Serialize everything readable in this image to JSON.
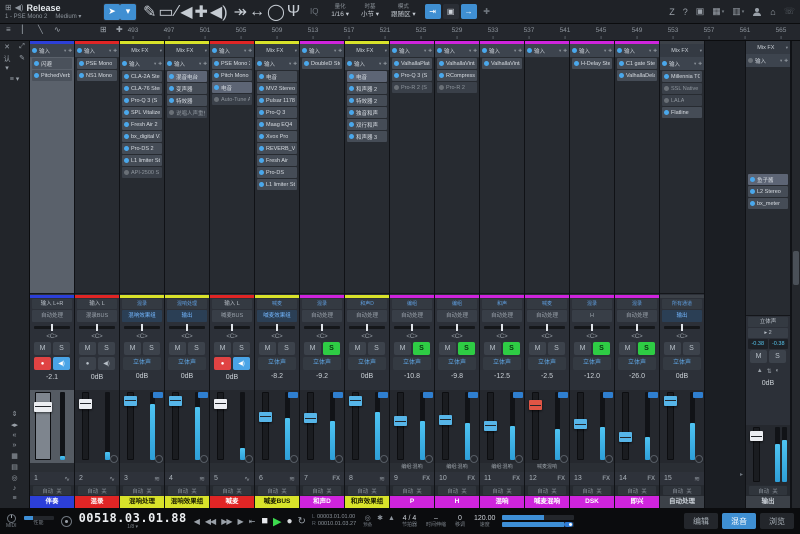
{
  "topbar": {
    "song_title": "Release",
    "selected_item": "1 - PSE Mono 2",
    "buffer": "Medium ▾",
    "window_icons": [
      "⊞",
      "◀)"
    ],
    "arrow_tool": "➤",
    "tools": [
      "✎",
      "▭",
      "∕",
      "◀",
      "✚",
      "◀)"
    ],
    "nav_tools": [
      "↠",
      "↔",
      "◯",
      "Ψ"
    ],
    "iq_label": "IQ",
    "quantize": {
      "label": "量化",
      "value": "1/16 ▾"
    },
    "timebase": {
      "label": "时基",
      "value": "小节 ▾"
    },
    "mode": {
      "label": "模式",
      "value": "跟随区 ▾"
    },
    "action_chips": [
      "⇥",
      "▣",
      "→",
      "✚"
    ],
    "right_icons": [
      "Z",
      "?",
      "▣",
      "▦ ▾",
      "▥ ▾",
      "⌂",
      "☏"
    ]
  },
  "toolbar2": {
    "icons_left": [
      "≡",
      "▏",
      "╲",
      "∿"
    ],
    "icons_mid": [
      "⊞",
      "✚"
    ]
  },
  "ruler": {
    "numbers": [
      493,
      497,
      501,
      505,
      509,
      513,
      517,
      521,
      525,
      529,
      533,
      537,
      541,
      545,
      549,
      553,
      557,
      561,
      565
    ]
  },
  "left_rail": {
    "top_icons": [
      "✕",
      "⤢",
      "认 ▾",
      "✎",
      "≡ ▾"
    ],
    "bottom_icons": [
      "⇕",
      "◂▸",
      "«",
      "»",
      "▦",
      "▤",
      "◎",
      "♪",
      "≡"
    ]
  },
  "labels": {
    "mixfx": "Mix FX",
    "input": "输入",
    "auto": "自动",
    "auto_state": "关",
    "pan_center": "<C>",
    "mute": "M",
    "solo": "S",
    "stereo": "立体声",
    "rec_glyph": "●",
    "mon_glyph": "◀)"
  },
  "channels": [
    {
      "num": "1",
      "name": "伴奏",
      "color": "#2c3fd8",
      "tc": "#ffffff",
      "selected": true,
      "mixfx": false,
      "inserts": [
        {
          "n": "闪避",
          "s": "hl"
        },
        {
          "n": "PitchedVerb",
          "s": ""
        }
      ],
      "input": "输入 L+R",
      "input_small": false,
      "bus": "自动处理",
      "bus_hl": false,
      "recmon": "rec",
      "rec_on": true,
      "solo_on": false,
      "gain": "-2.1",
      "cap": "#eceef2",
      "cappos": 16,
      "meter": 6,
      "icon": "∿",
      "send": "",
      "badge": false
    },
    {
      "num": "2",
      "name": "混录",
      "color": "#e02525",
      "tc": "#ffffff",
      "selected": false,
      "mixfx": false,
      "inserts": [
        {
          "n": "PSE Mono",
          "s": ""
        },
        {
          "n": "NS1 Mono",
          "s": ""
        }
      ],
      "input": "输入 L",
      "input_small": false,
      "bus": "混录BUS",
      "bus_hl": false,
      "recmon": "rec",
      "rec_on": false,
      "solo_on": false,
      "gain": "0dB",
      "cap": "#eceef2",
      "cappos": 12,
      "meter": 12,
      "icon": "∿",
      "send": "",
      "badge": false
    },
    {
      "num": "3",
      "name": "混响处理",
      "color": "#d8e22a",
      "tc": "#1a1d00",
      "selected": false,
      "mixfx": true,
      "inserts": [
        {
          "n": "CLA-2A Ster",
          "s": ""
        },
        {
          "n": "CLA-76 Ster",
          "s": ""
        },
        {
          "n": "Pro-Q 3 (S",
          "s": ""
        },
        {
          "n": "SPL Vitalizer",
          "s": ""
        },
        {
          "n": "Fresh Air 2",
          "s": ""
        },
        {
          "n": "bx_digital V3",
          "s": ""
        },
        {
          "n": "Pro-DS 2",
          "s": ""
        },
        {
          "n": "L1 limiter St",
          "s": ""
        },
        {
          "n": "API-2500 S",
          "s": "dim"
        }
      ],
      "input": "混录",
      "input_small": true,
      "bus": "混响效果组",
      "bus_hl": true,
      "recmon": "stereo",
      "rec_on": false,
      "solo_on": false,
      "gain": "0dB",
      "cap": "#56b5e8",
      "cappos": 8,
      "meter": 82,
      "icon": "≋",
      "send": "",
      "badge": true
    },
    {
      "num": "4",
      "name": "混响效果组",
      "color": "#d8e22a",
      "tc": "#1a1d00",
      "selected": false,
      "mixfx": true,
      "inserts": [
        {
          "n": "混音电台",
          "s": "hl"
        },
        {
          "n": "变声器",
          "s": ""
        },
        {
          "n": "特效器",
          "s": ""
        },
        {
          "n": "说唱人声重叠",
          "s": "dim"
        }
      ],
      "input": "混响处理",
      "input_small": true,
      "bus": "输出",
      "bus_hl": true,
      "recmon": "stereo",
      "rec_on": false,
      "solo_on": false,
      "gain": "0dB",
      "cap": "#56b5e8",
      "cappos": 8,
      "meter": 78,
      "icon": "≋",
      "send": "",
      "badge": true
    },
    {
      "num": "5",
      "name": "喊麦",
      "color": "#e02525",
      "tc": "#ffffff",
      "selected": false,
      "mixfx": false,
      "inserts": [
        {
          "n": "PSE Mono 2",
          "s": ""
        },
        {
          "n": "Pitch Mono",
          "s": ""
        },
        {
          "n": "电音",
          "s": "hl"
        },
        {
          "n": "Auto-Tune Ar",
          "s": "dim"
        }
      ],
      "input": "输入 L",
      "input_small": false,
      "bus": "喊麦BUS",
      "bus_hl": false,
      "recmon": "rec",
      "rec_on": true,
      "solo_on": false,
      "gain": "0dB",
      "cap": "#eceef2",
      "cappos": 12,
      "meter": 18,
      "icon": "∿",
      "send": "",
      "badge": false
    },
    {
      "num": "6",
      "name": "喊麦BUS",
      "color": "#d8e22a",
      "tc": "#1a1d00",
      "selected": false,
      "mixfx": true,
      "inserts": [
        {
          "n": "电音",
          "s": ""
        },
        {
          "n": "MV2 Stereo",
          "s": ""
        },
        {
          "n": "Pulsar 1178",
          "s": ""
        },
        {
          "n": "Pro-Q 3",
          "s": ""
        },
        {
          "n": "Maag EQ4",
          "s": ""
        },
        {
          "n": "Xvox Pro",
          "s": ""
        },
        {
          "n": "REVERB_VE",
          "s": ""
        },
        {
          "n": "Fresh Air",
          "s": ""
        },
        {
          "n": "Pro-DS",
          "s": ""
        },
        {
          "n": "L1 limiter St",
          "s": ""
        }
      ],
      "input": "喊麦",
      "input_small": true,
      "bus": "喊麦效果组",
      "bus_hl": true,
      "recmon": "stereo",
      "rec_on": false,
      "solo_on": false,
      "gain": "-8.2",
      "cap": "#56b5e8",
      "cappos": 30,
      "meter": 62,
      "icon": "≋",
      "send": "",
      "badge": true
    },
    {
      "num": "7",
      "name": "和声D",
      "color": "#cf24dd",
      "tc": "#ffffff",
      "selected": false,
      "mixfx": false,
      "inserts": [
        {
          "n": "DoubleD Ste",
          "s": ""
        }
      ],
      "input": "混录",
      "input_small": true,
      "bus": "自动处理",
      "bus_hl": false,
      "recmon": "stereo",
      "rec_on": false,
      "solo_on": true,
      "gain": "-9.2",
      "cap": "#56b5e8",
      "cappos": 32,
      "meter": 58,
      "icon": "FX",
      "send": "",
      "badge": true
    },
    {
      "num": "8",
      "name": "和声效果组",
      "color": "#d8e22a",
      "tc": "#1a1d00",
      "selected": false,
      "mixfx": true,
      "inserts": [
        {
          "n": "电音",
          "s": "hl"
        },
        {
          "n": "和声器 2",
          "s": ""
        },
        {
          "n": "特效器 2",
          "s": ""
        },
        {
          "n": "独音和声",
          "s": ""
        },
        {
          "n": "双行和声",
          "s": ""
        },
        {
          "n": "和声器 3",
          "s": ""
        }
      ],
      "input": "和声D",
      "input_small": true,
      "bus": "自动处理",
      "bus_hl": false,
      "recmon": "stereo",
      "rec_on": false,
      "solo_on": false,
      "gain": "0dB",
      "cap": "#56b5e8",
      "cappos": 8,
      "meter": 70,
      "icon": "≋",
      "send": "",
      "badge": true
    },
    {
      "num": "9",
      "name": "P",
      "color": "#cf24dd",
      "tc": "#ffffff",
      "selected": false,
      "mixfx": false,
      "inserts": [
        {
          "n": "ValhallaPlate",
          "s": ""
        },
        {
          "n": "Pro-Q 3 (S",
          "s": ""
        },
        {
          "n": "Pro-R 2 (S",
          "s": "dim"
        }
      ],
      "input": "编组",
      "input_small": true,
      "bus": "自动处理",
      "bus_hl": false,
      "recmon": "stereo",
      "rec_on": false,
      "solo_on": true,
      "gain": "-10.8",
      "cap": "#56b5e8",
      "cappos": 36,
      "meter": 58,
      "icon": "FX",
      "send": "编组:混响",
      "badge": true
    },
    {
      "num": "10",
      "name": "H",
      "color": "#cf24dd",
      "tc": "#ffffff",
      "selected": false,
      "mixfx": false,
      "inserts": [
        {
          "n": "ValhallaVinta",
          "s": ""
        },
        {
          "n": "RCompressor",
          "s": ""
        },
        {
          "n": "Pro-R 2",
          "s": "dim"
        }
      ],
      "input": "编组",
      "input_small": true,
      "bus": "自动处理",
      "bus_hl": false,
      "recmon": "stereo",
      "rec_on": false,
      "solo_on": true,
      "gain": "-9.8",
      "cap": "#56b5e8",
      "cappos": 34,
      "meter": 55,
      "icon": "FX",
      "send": "编组:混响",
      "badge": true
    },
    {
      "num": "11",
      "name": "混响",
      "color": "#cf24dd",
      "tc": "#ffffff",
      "selected": false,
      "mixfx": false,
      "inserts": [
        {
          "n": "ValhallaVinta",
          "s": ""
        }
      ],
      "input": "和声",
      "input_small": true,
      "bus": "自动处理",
      "bus_hl": false,
      "recmon": "stereo",
      "rec_on": false,
      "solo_on": true,
      "gain": "-12.5",
      "cap": "#56b5e8",
      "cappos": 42,
      "meter": 50,
      "icon": "FX",
      "send": "编组:混响",
      "badge": true
    },
    {
      "num": "12",
      "name": "喊麦混响",
      "color": "#cf24dd",
      "tc": "#ffffff",
      "selected": false,
      "mixfx": false,
      "inserts": [],
      "input": "喊麦",
      "input_small": true,
      "bus": "自动处理",
      "bus_hl": false,
      "recmon": "stereo",
      "rec_on": false,
      "solo_on": false,
      "gain": "-2.5",
      "cap": "#e05545",
      "cappos": 14,
      "meter": 45,
      "icon": "FX",
      "send": "喊麦混响",
      "badge": true
    },
    {
      "num": "13",
      "name": "DSK",
      "color": "#cf24dd",
      "tc": "#ffffff",
      "selected": false,
      "mixfx": false,
      "inserts": [
        {
          "n": "H-Delay Ster",
          "s": ""
        }
      ],
      "input": "混录",
      "input_small": true,
      "bus": "H",
      "bus_hl": false,
      "recmon": "stereo",
      "rec_on": false,
      "solo_on": true,
      "gain": "-12.0",
      "cap": "#56b5e8",
      "cappos": 40,
      "meter": 48,
      "icon": "FX",
      "send": "",
      "badge": true
    },
    {
      "num": "14",
      "name": "即兴",
      "color": "#cf24dd",
      "tc": "#ffffff",
      "selected": false,
      "mixfx": false,
      "inserts": [
        {
          "n": "C1 gate Ster",
          "s": ""
        },
        {
          "n": "ValhallaDelay",
          "s": ""
        }
      ],
      "input": "混录",
      "input_small": true,
      "bus": "自动处理",
      "bus_hl": false,
      "recmon": "stereo",
      "rec_on": false,
      "solo_on": true,
      "gain": "-26.0",
      "cap": "#56b5e8",
      "cappos": 58,
      "meter": 34,
      "icon": "FX",
      "send": "",
      "badge": true
    },
    {
      "num": "15",
      "name": "自动处理",
      "color": "#3c4148",
      "tc": "#ccd2d9",
      "selected": false,
      "mixfx": true,
      "inserts": [
        {
          "n": "Millennia TC",
          "s": ""
        },
        {
          "n": "SSL Native B",
          "s": "dim"
        },
        {
          "n": "LALA",
          "s": "dim"
        },
        {
          "n": "Flatline",
          "s": ""
        }
      ],
      "input": "所有通道",
      "input_small": true,
      "bus": "输出",
      "bus_hl": true,
      "recmon": "stereo",
      "rec_on": false,
      "solo_on": false,
      "gain": "0dB",
      "cap": "#56b5e8",
      "cappos": 8,
      "meter": 55,
      "icon": "≋",
      "send": "",
      "badge": true
    }
  ],
  "master": {
    "name": "输出",
    "color": "#3c4148",
    "tc": "#ccd2d9",
    "inserts": [
      {
        "n": "鱼子酱",
        "s": "hl"
      },
      {
        "n": "L2 Stereo",
        "s": ""
      },
      {
        "n": "bx_meter",
        "s": ""
      }
    ],
    "stereo_row": "立体声",
    "boost": "▸ 2",
    "peaks": [
      "-0.38",
      "-0.38"
    ],
    "icons": [
      "▲",
      "⇅",
      "◐"
    ],
    "gain": "0dB",
    "cap": "#eceef2",
    "cappos": 10,
    "meters": [
      76,
      70
    ]
  },
  "transport": {
    "midi": "MIDI",
    "performance": "性能",
    "time": "00518.03.01.88",
    "time_sub": "1/8 ▾",
    "nav_buttons": [
      "◀",
      "◀◀",
      "▶▶",
      "▶",
      "⇤"
    ],
    "stop": "■",
    "play": "▶",
    "record": "●",
    "loop": "↻",
    "loop_start": "00003.01.01.00",
    "loop_end": "00010.01.03.27",
    "small_icons": [
      {
        "g": "◎",
        "l": "预备"
      },
      {
        "g": "✱",
        "l": ""
      },
      {
        "g": "▲",
        "l": ""
      }
    ],
    "fields": [
      {
        "value": "4 / 4",
        "label": "节拍器"
      },
      {
        "value": "–",
        "label": "时间伸缩"
      },
      {
        "value": "0",
        "label": "移调"
      },
      {
        "value": "120.00",
        "label": "速度"
      }
    ],
    "meter_fills": [
      58,
      86
    ],
    "view_buttons": [
      {
        "label": "编辑",
        "active": false
      },
      {
        "label": "混音",
        "active": true
      },
      {
        "label": "浏览",
        "active": false
      }
    ]
  }
}
